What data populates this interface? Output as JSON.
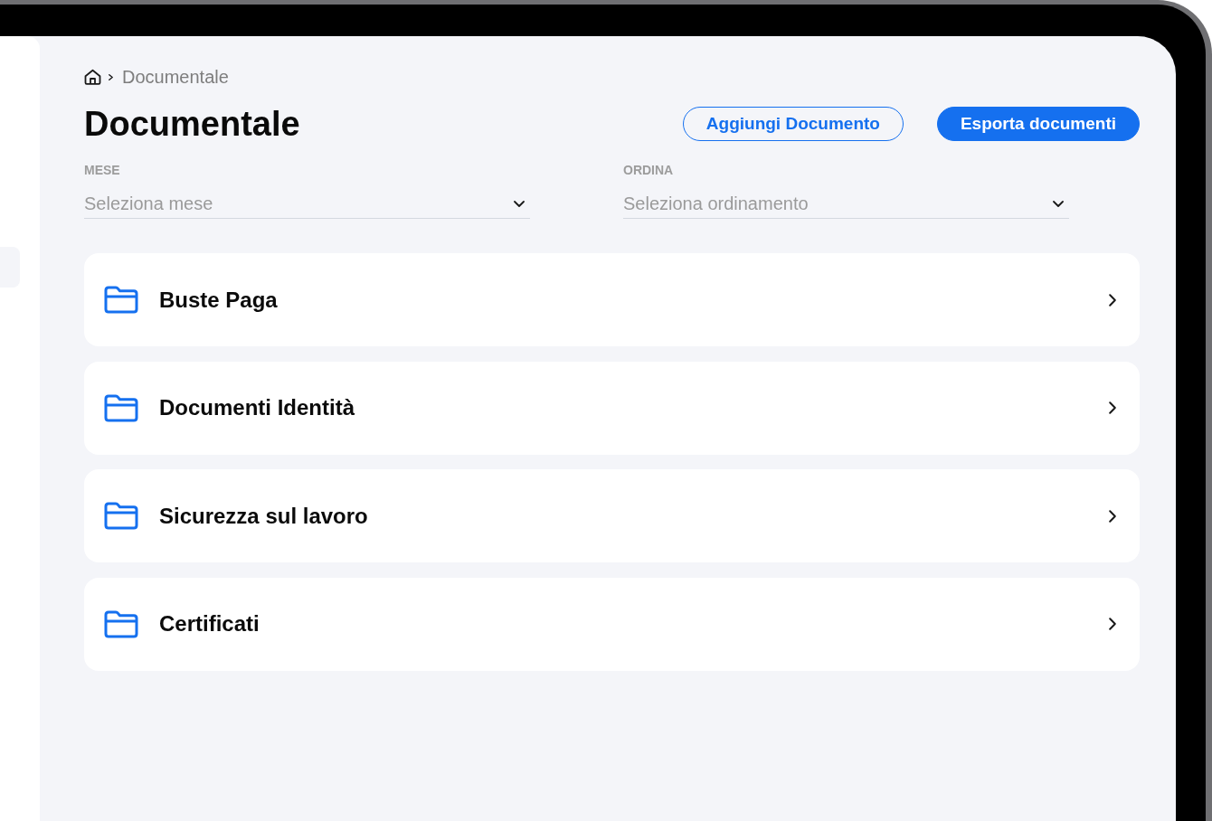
{
  "breadcrumb": {
    "current": "Documentale"
  },
  "title": "Documentale",
  "actions": [
    {
      "label": "Aggiungi Documento",
      "kind": "outline"
    },
    {
      "label": "Esporta documenti",
      "kind": "primary"
    }
  ],
  "filters": [
    {
      "label": "MESE",
      "placeholder": "Seleziona mese"
    },
    {
      "label": "ORDINA",
      "placeholder": "Seleziona ordinamento"
    }
  ],
  "folders": [
    {
      "name": "Buste Paga"
    },
    {
      "name": "Documenti Identità"
    },
    {
      "name": "Sicurezza sul lavoro"
    },
    {
      "name": "Certificati"
    }
  ]
}
